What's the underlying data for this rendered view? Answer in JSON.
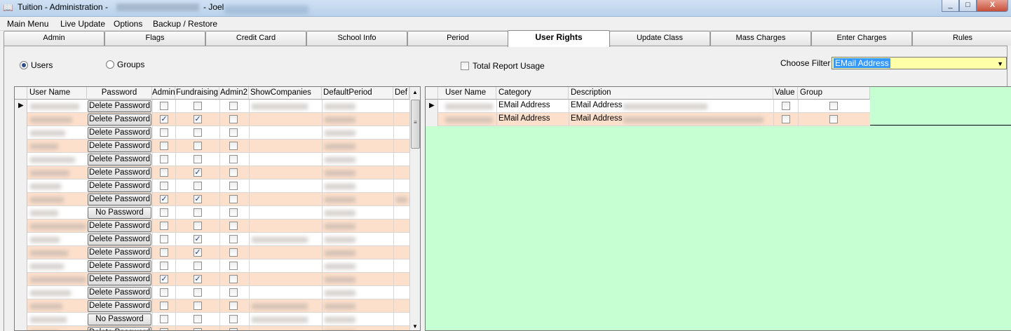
{
  "window": {
    "title": "Tuition - Administration -",
    "user": "- Joel",
    "buttons": {
      "minimize": "_",
      "maximize": "□",
      "close": "X"
    }
  },
  "menu": [
    {
      "label": "Main Menu"
    },
    {
      "label": "Live Update"
    },
    {
      "label": "Options"
    },
    {
      "label": "Backup / Restore"
    }
  ],
  "tabs": [
    {
      "label": "Admin"
    },
    {
      "label": "Flags"
    },
    {
      "label": "Credit Card"
    },
    {
      "label": "School Info"
    },
    {
      "label": "Period"
    },
    {
      "label": "User Rights",
      "active": true
    },
    {
      "label": "Update Class"
    },
    {
      "label": "Mass Charges"
    },
    {
      "label": "Enter Charges"
    },
    {
      "label": "Rules"
    }
  ],
  "options": {
    "users_label": "Users",
    "groups_label": "Groups",
    "selected": "Users",
    "total_report_label": "Total Report Usage",
    "total_report_checked": false,
    "filter_label": "Choose Filter",
    "filter_value": "EMail Address"
  },
  "left_grid": {
    "columns": [
      "User Name",
      "Password",
      "Admin",
      "Fundraising",
      "Admin2",
      "ShowCompanies",
      "DefaultPeriod",
      "Def"
    ],
    "rows": [
      {
        "password": "Delete Password",
        "admin": false,
        "fundraising": false,
        "admin2": false
      },
      {
        "password": "Delete Password",
        "admin": true,
        "fundraising": true,
        "admin2": false
      },
      {
        "password": "Delete Password",
        "admin": false,
        "fundraising": false,
        "admin2": false
      },
      {
        "password": "Delete Password",
        "admin": false,
        "fundraising": false,
        "admin2": false
      },
      {
        "password": "Delete Password",
        "admin": false,
        "fundraising": false,
        "admin2": false
      },
      {
        "password": "Delete Password",
        "admin": false,
        "fundraising": true,
        "admin2": false
      },
      {
        "password": "Delete Password",
        "admin": false,
        "fundraising": false,
        "admin2": false
      },
      {
        "password": "Delete Password",
        "admin": true,
        "fundraising": true,
        "admin2": false
      },
      {
        "password": "No Password",
        "admin": false,
        "fundraising": false,
        "admin2": false
      },
      {
        "password": "Delete Password",
        "admin": false,
        "fundraising": false,
        "admin2": false
      },
      {
        "password": "Delete Password",
        "admin": false,
        "fundraising": true,
        "admin2": false
      },
      {
        "password": "Delete Password",
        "admin": false,
        "fundraising": true,
        "admin2": false
      },
      {
        "password": "Delete Password",
        "admin": false,
        "fundraising": false,
        "admin2": false
      },
      {
        "password": "Delete Password",
        "admin": true,
        "fundraising": true,
        "admin2": false
      },
      {
        "password": "Delete Password",
        "admin": false,
        "fundraising": false,
        "admin2": false
      },
      {
        "password": "Delete Password",
        "admin": false,
        "fundraising": false,
        "admin2": false
      },
      {
        "password": "No Password",
        "admin": false,
        "fundraising": false,
        "admin2": false
      },
      {
        "password": "Delete Password",
        "admin": false,
        "fundraising": false,
        "admin2": false
      }
    ]
  },
  "right_grid": {
    "columns": [
      "User Name",
      "Category",
      "Description",
      "Value",
      "Group"
    ],
    "rows": [
      {
        "category": "EMail Address",
        "description": "EMail Address",
        "value": false,
        "group": false
      },
      {
        "category": "EMail Address",
        "description": "EMail Address",
        "value": false,
        "group": false
      }
    ]
  }
}
